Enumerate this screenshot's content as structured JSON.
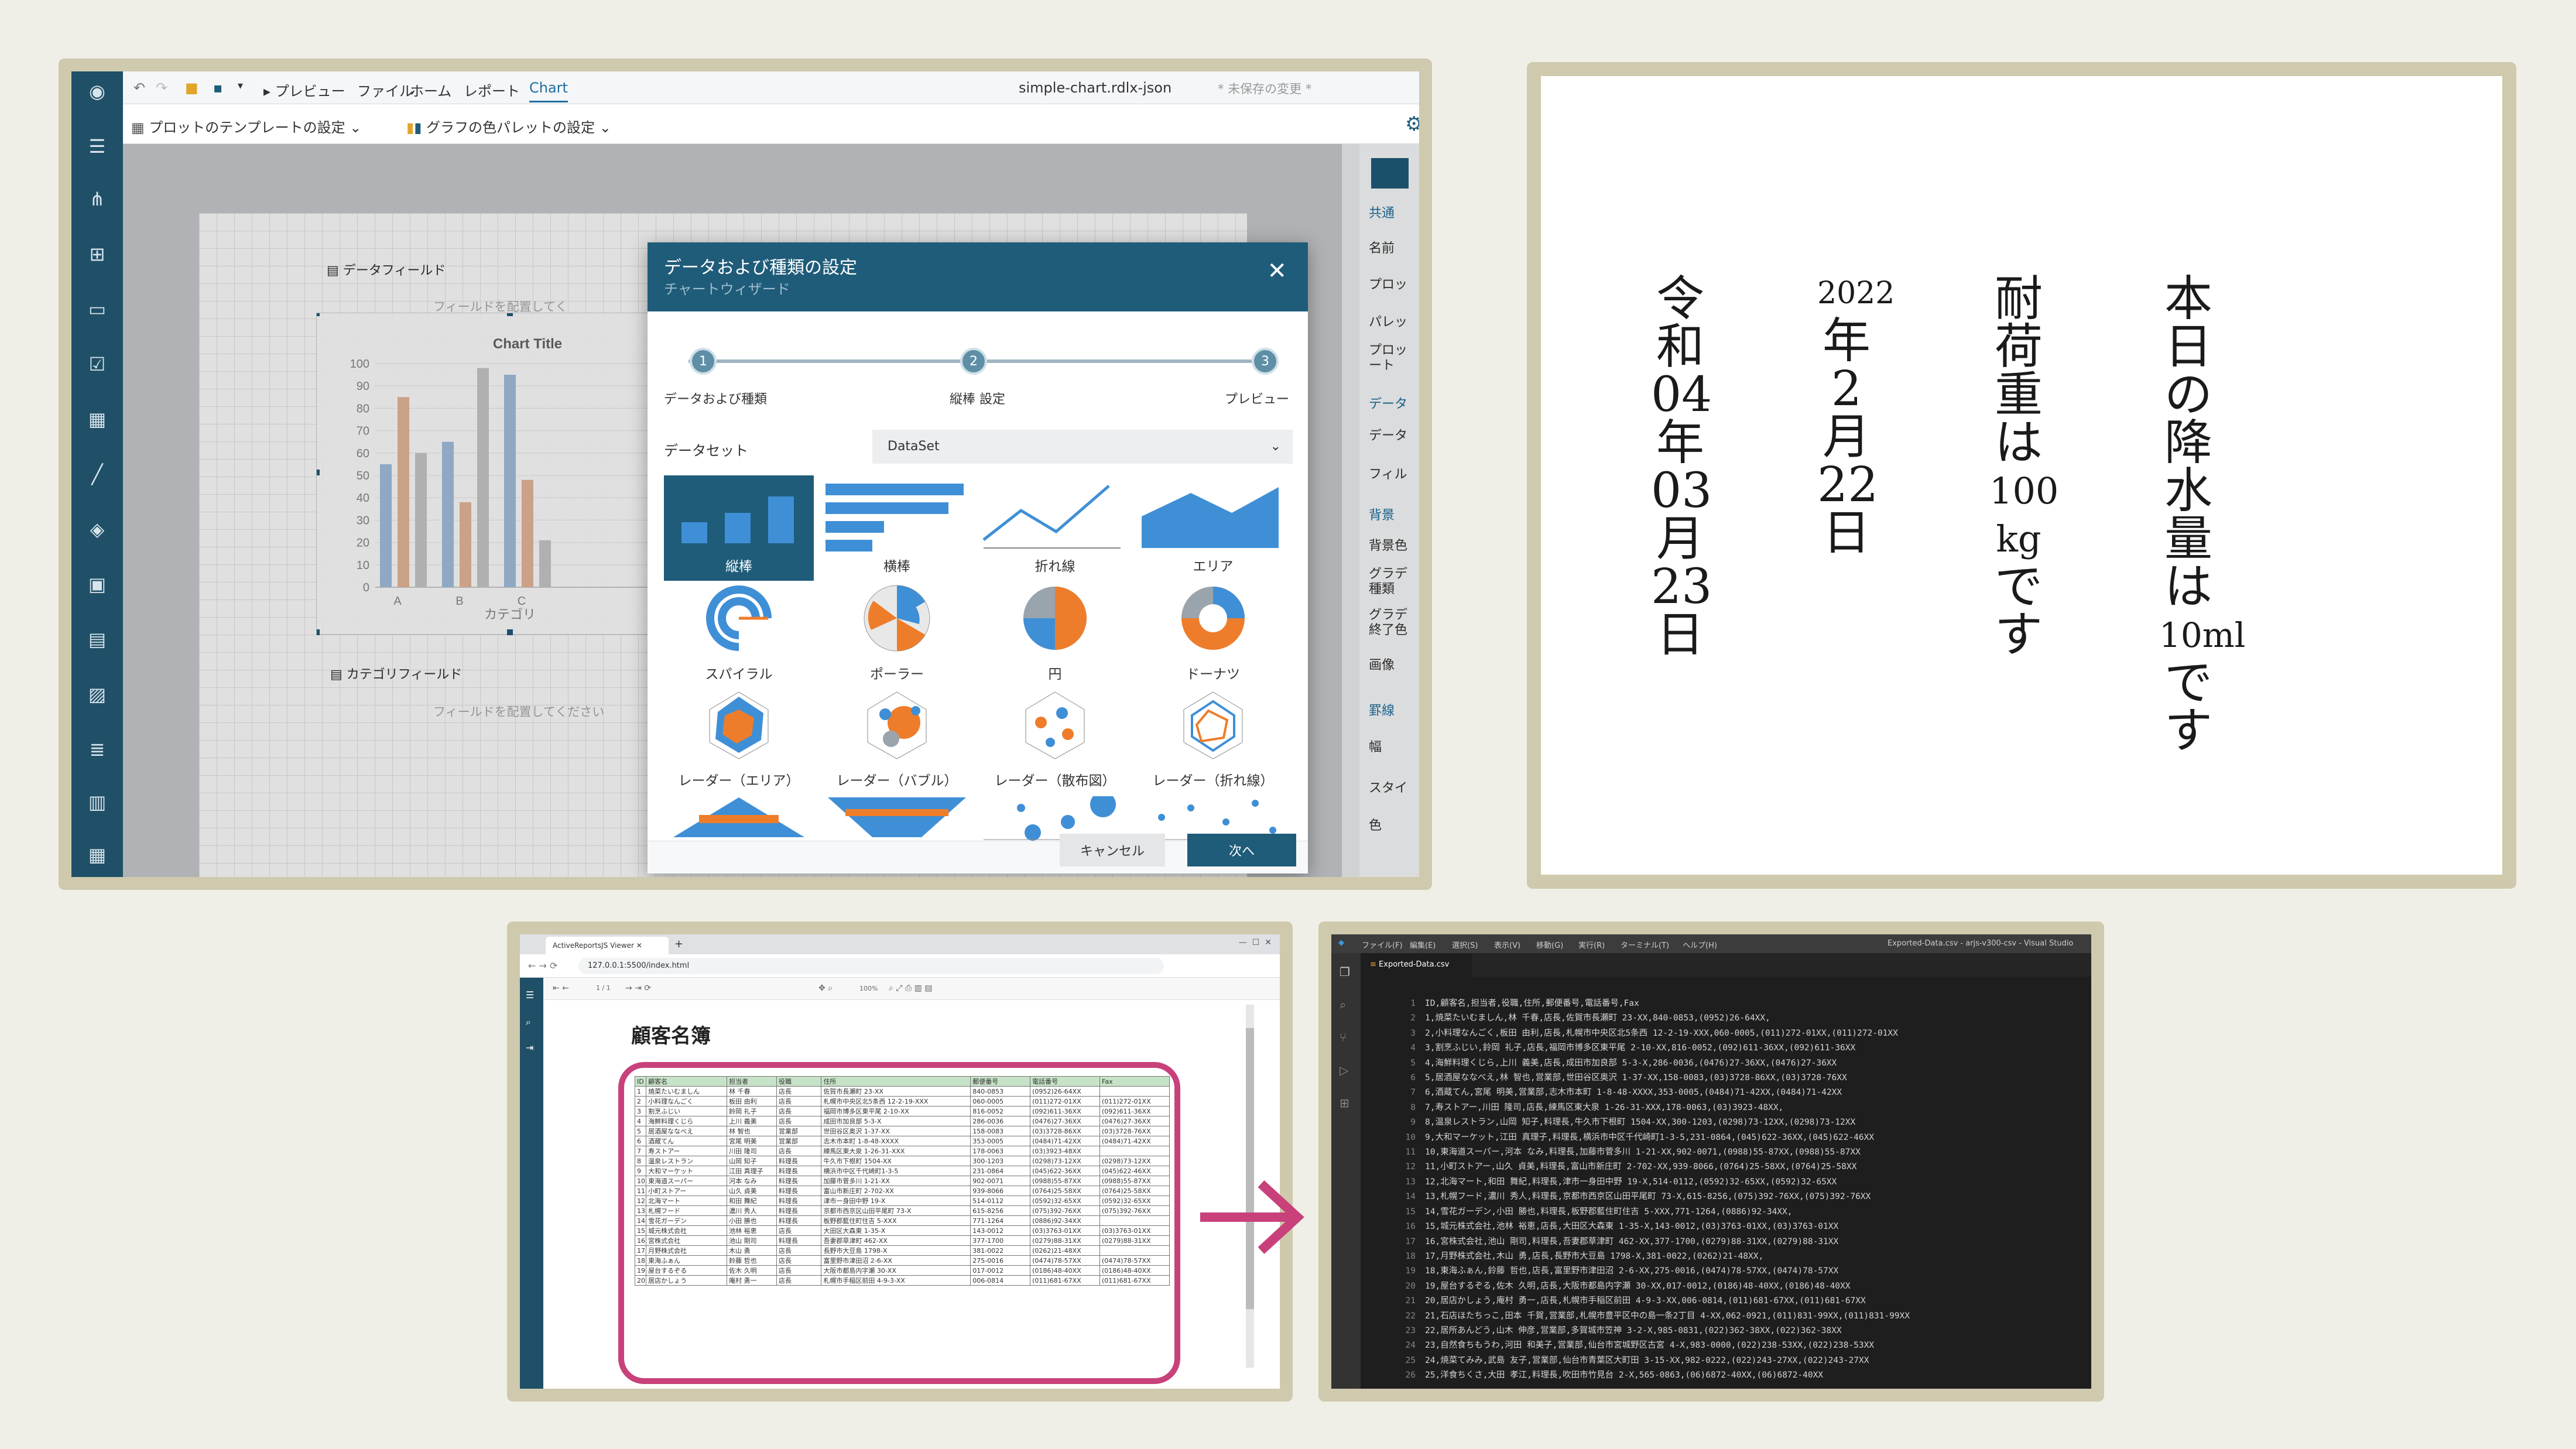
{
  "designer": {
    "toolbar": {
      "preview": "プレビュー",
      "menus": [
        "ファイル",
        "ホーム",
        "レポート",
        "Chart"
      ],
      "active_menu": "Chart",
      "filename": "simple-chart.rdlx-json",
      "unsaved": "* 未保存の変更 *"
    },
    "subbar": {
      "plot_template": "プロットのテンプレートの設定",
      "palette": "グラフの色パレットの設定"
    },
    "canvas": {
      "data_field": "データフィールド",
      "data_field_hint": "フィールドを配置してく",
      "category_field": "カテゴリフィールド",
      "category_field_hint": "フィールドを配置してください",
      "chart_data": {
        "type": "bar",
        "title": "Chart Title",
        "xlabel": "カテゴリ",
        "ylabel": "",
        "categories": [
          "A",
          "B",
          "C"
        ],
        "yticks": [
          "100",
          "90",
          "80",
          "70",
          "60",
          "50",
          "40",
          "30",
          "20",
          "10",
          "0"
        ],
        "ylim": [
          0,
          100
        ],
        "series": [
          {
            "color": "#a3c0de",
            "values": [
              55,
              65,
              95
            ]
          },
          {
            "color": "#e8b89a",
            "values": [
              85,
              38,
              48
            ]
          },
          {
            "color": "#c9c9c9",
            "values": [
              60,
              98,
              21
            ]
          }
        ]
      }
    },
    "properties": {
      "items": [
        "共通",
        "名前",
        "プロッ",
        "パレッ",
        "プロッ\nート",
        "データ",
        "データ",
        "フィル",
        "背景",
        "背景色",
        "グラデ\n種類",
        "グラデ\n終了色",
        "画像",
        "罫線",
        "幅",
        "スタイ",
        "色"
      ]
    },
    "dialog": {
      "title": "データおよび種類の設定",
      "subtitle": "チャートウィザード",
      "steps": [
        {
          "num": "1",
          "label": "データおよび種類"
        },
        {
          "num": "2",
          "label": "縦棒 設定"
        },
        {
          "num": "3",
          "label": "プレビュー"
        }
      ],
      "dataset_label": "データセット",
      "dataset_value": "DataSet",
      "chart_types": [
        "縦棒",
        "横棒",
        "折れ線",
        "エリア",
        "スパイラル",
        "ポーラー",
        "円",
        "ドーナツ",
        "レーダー（エリア）",
        "レーダー（バブル）",
        "レーダー（散布図）",
        "レーダー（折れ線）"
      ],
      "cancel": "キャンセル",
      "next": "次へ",
      "colors": {
        "header": "#1f5c7a",
        "accent": "#3f8fd6",
        "orange": "#ee7d2b"
      }
    }
  },
  "vertical_text": {
    "columns": [
      [
        "本",
        "日",
        "の",
        "降",
        "水",
        "量",
        "は",
        "10ml",
        "で",
        "す"
      ],
      [
        "耐",
        "荷",
        "重",
        "は",
        "100",
        "kg",
        "で",
        "す"
      ],
      [
        "2022",
        "年",
        "2",
        "月",
        "22",
        "日"
      ],
      [
        "令",
        "和",
        "04",
        "年",
        "03",
        "月",
        "23",
        "日"
      ]
    ]
  },
  "viewer": {
    "tab_title": "ActiveReportsJS Viewer",
    "url": "127.0.0.1:5500/index.html",
    "page_indicator": "1 / 1",
    "zoom": "100%",
    "report_title": "顧客名簿",
    "columns": [
      "ID",
      "顧客名",
      "担当者",
      "役職",
      "住所",
      "郵便番号",
      "電話番号",
      "Fax"
    ],
    "rows": [
      [
        "1",
        "焼菜たいむましん",
        "林 千春",
        "店長",
        "佐賀市長瀬町 23-XX",
        "840-0853",
        "(0952)26-64XX",
        ""
      ],
      [
        "2",
        "小料理なんごく",
        "板田 由利",
        "店長",
        "札幌市中央区北5条西 12-2-19-XXX",
        "060-0005",
        "(011)272-01XX",
        "(011)272-01XX"
      ],
      [
        "3",
        "割烹ふじい",
        "鈴岡 礼子",
        "店長",
        "福岡市博多区東平尾 2-10-XX",
        "816-0052",
        "(092)611-36XX",
        "(092)611-36XX"
      ],
      [
        "4",
        "海鮮料理くじら",
        "上川 義美",
        "店長",
        "成田市加良部 5-3-X",
        "286-0036",
        "(0476)27-36XX",
        "(0476)27-36XX"
      ],
      [
        "5",
        "居酒屋ななべえ",
        "林 智也",
        "営業部",
        "世田谷区奥沢 1-37-XX",
        "158-0083",
        "(03)3728-86XX",
        "(03)3728-76XX"
      ],
      [
        "6",
        "酒蔵てん",
        "宮尾 明美",
        "営業部",
        "志木市本町 1-8-48-XXXX",
        "353-0005",
        "(0484)71-42XX",
        "(0484)71-42XX"
      ],
      [
        "7",
        "寿ストアー",
        "川田 隆司",
        "店長",
        "練馬区東大泉 1-26-31-XXX",
        "178-0063",
        "(03)3923-48XX",
        ""
      ],
      [
        "8",
        "温泉レストラン",
        "山岡 知子",
        "料理長",
        "牛久市下根町 1504-XX",
        "300-1203",
        "(0298)73-12XX",
        "(0298)73-12XX"
      ],
      [
        "9",
        "大和マーケット",
        "江田 真理子",
        "料理長",
        "横浜市中区千代崎町1-3-5",
        "231-0864",
        "(045)622-36XX",
        "(045)622-46XX"
      ],
      [
        "10",
        "東海道スーパー",
        "河本 なみ",
        "料理長",
        "加藤市菅多川 1-21-XX",
        "902-0071",
        "(0988)55-87XX",
        "(0988)55-87XX"
      ],
      [
        "11",
        "小町ストアー",
        "山久 貞美",
        "料理長",
        "富山市新庄町 2-702-XX",
        "939-8066",
        "(0764)25-58XX",
        "(0764)25-58XX"
      ],
      [
        "12",
        "北海マート",
        "和田 舞紀",
        "料理長",
        "津市一身田中野 19-X",
        "514-0112",
        "(0592)32-65XX",
        "(0592)32-65XX"
      ],
      [
        "13",
        "札幌フード",
        "濃川 秀人",
        "料理長",
        "京都市西京区山田平尾町 73-X",
        "615-8256",
        "(075)392-76XX",
        "(075)392-76XX"
      ],
      [
        "14",
        "雪花ガーデン",
        "小田 勝也",
        "料理長",
        "板野郡藍住町住吉 5-XXX",
        "771-1264",
        "(0886)92-34XX",
        ""
      ],
      [
        "15",
        "城元株式会社",
        "池林 裕恵",
        "店長",
        "大田区大森東 1-35-X",
        "143-0012",
        "(03)3763-01XX",
        "(03)3763-01XX"
      ],
      [
        "16",
        "宮株式会社",
        "池山 剛司",
        "料理長",
        "吾妻郡草津町 462-XX",
        "377-1700",
        "(0279)88-31XX",
        "(0279)88-31XX"
      ],
      [
        "17",
        "月野株式会社",
        "木山 勇",
        "店長",
        "長野市大豆島 1798-X",
        "381-0022",
        "(0262)21-48XX",
        ""
      ],
      [
        "18",
        "東海ふぁん",
        "鈴藤 哲也",
        "店長",
        "富里野市津田沼 2-6-XX",
        "275-0016",
        "(0474)78-57XX",
        "(0474)78-57XX"
      ],
      [
        "19",
        "屋台するぞる",
        "佐木 久明",
        "店長",
        "大阪市都島内字瀬 30-XX",
        "017-0012",
        "(0186)48-40XX",
        "(0186)48-40XX"
      ],
      [
        "20",
        "居店かしょう",
        "庵村 勇一",
        "店長",
        "札幌市手稲区前田 4-9-3-XX",
        "006-0814",
        "(011)681-67XX",
        "(011)681-67XX"
      ]
    ]
  },
  "vscode": {
    "menus": [
      "ファイル(F)",
      "編集(E)",
      "選択(S)",
      "表示(V)",
      "移動(G)",
      "実行(R)",
      "ターミナル(T)",
      "ヘルプ(H)"
    ],
    "title": "Exported-Data.csv - arjs-v300-csv - Visual Studio",
    "tab": "Exported-Data.csv",
    "lines": [
      "ID,顧客名,担当者,役職,住所,郵便番号,電話番号,Fax",
      "1,焼菜たいむましん,林 千春,店長,佐賀市長瀬町 23-XX,840-0853,(0952)26-64XX,",
      "2,小料理なんごく,板田 由利,店長,札幌市中央区北5条西 12-2-19-XXX,060-0005,(011)272-01XX,(011)272-01XX",
      "3,割烹ふじい,鈴岡 礼子,店長,福岡市博多区東平尾 2-10-XX,816-0052,(092)611-36XX,(092)611-36XX",
      "4,海鮮料理くじら,上川 義美,店長,成田市加良部 5-3-X,286-0036,(0476)27-36XX,(0476)27-36XX",
      "5,居酒屋ななべえ,林 智也,営業部,世田谷区奥沢 1-37-XX,158-0083,(03)3728-86XX,(03)3728-76XX",
      "6,酒蔵てん,宮尾 明美,営業部,志木市本町 1-8-48-XXXX,353-0005,(0484)71-42XX,(0484)71-42XX",
      "7,寿ストアー,川田 隆司,店長,練馬区東大泉 1-26-31-XXX,178-0063,(03)3923-48XX,",
      "8,温泉レストラン,山岡 知子,料理長,牛久市下根町 1504-XX,300-1203,(0298)73-12XX,(0298)73-12XX",
      "9,大和マーケット,江田 真理子,料理長,横浜市中区千代崎町1-3-5,231-0864,(045)622-36XX,(045)622-46XX",
      "10,東海道スーパー,河本 なみ,料理長,加藤市菅多川 1-21-XX,902-0071,(0988)55-87XX,(0988)55-87XX",
      "11,小町ストアー,山久 貞美,料理長,富山市新庄町 2-702-XX,939-8066,(0764)25-58XX,(0764)25-58XX",
      "12,北海マート,和田 舞紀,料理長,津市一身田中野 19-X,514-0112,(0592)32-65XX,(0592)32-65XX",
      "13,札幌フード,濃川 秀人,料理長,京都市西京区山田平尾町 73-X,615-8256,(075)392-76XX,(075)392-76XX",
      "14,雪花ガーデン,小田 勝也,料理長,板野郡藍住町住吉 5-XXX,771-1264,(0886)92-34XX,",
      "15,城元株式会社,池林 裕恵,店長,大田区大森東 1-35-X,143-0012,(03)3763-01XX,(03)3763-01XX",
      "16,宮株式会社,池山 剛司,料理長,吾妻郡草津町 462-XX,377-1700,(0279)88-31XX,(0279)88-31XX",
      "17,月野株式会社,木山 勇,店長,長野市大豆島 1798-X,381-0022,(0262)21-48XX,",
      "18,東海ふぁん,鈴藤 哲也,店長,富里野市津田沼 2-6-XX,275-0016,(0474)78-57XX,(0474)78-57XX",
      "19,屋台するぞる,佐木 久明,店長,大阪市都島内字瀬 30-XX,017-0012,(0186)48-40XX,(0186)48-40XX",
      "20,居店かしょう,庵村 勇一,店長,札幌市手稲区前田 4-9-3-XX,006-0814,(011)681-67XX,(011)681-67XX",
      "21,石店ほたちっこ,田本 千賀,営業部,札幌市豊平区中の島一条2丁目 4-XX,062-0921,(011)831-99XX,(011)831-99XX",
      "22,居所あんどう,山木 伸彦,営業部,多賀城市笠神 3-2-X,985-0831,(022)362-38XX,(022)362-38XX",
      "23,自然食ちもうわ,河田 和美子,営業部,仙台市宮城野区古宮 4-X,983-0000,(022)238-53XX,(022)238-53XX",
      "24,焼菜てみみ,武島 友子,営業部,仙台市青葉区大町田 3-15-XX,982-0222,(022)243-27XX,(022)243-27XX",
      "25,洋食ちくさ,大田 孝江,料理長,吹田市竹見台 2-X,565-0863,(06)6872-40XX,(06)6872-40XX"
    ]
  }
}
